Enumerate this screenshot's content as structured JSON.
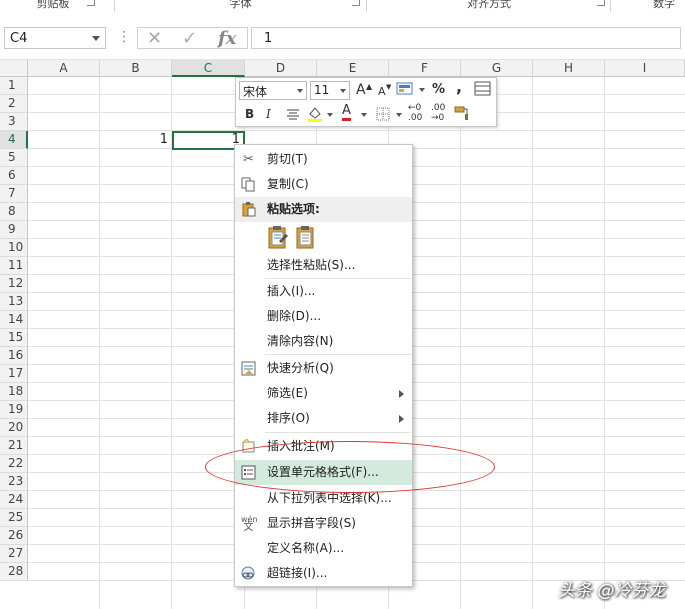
{
  "ribbon": {
    "groups": [
      "剪贴板",
      "字体",
      "对齐方式",
      "数字"
    ]
  },
  "formula_bar": {
    "name_box": "C4",
    "cancel_icon": "✕",
    "enter_icon": "✓",
    "fx_label": "fx",
    "value": "1"
  },
  "columns": [
    "A",
    "B",
    "C",
    "D",
    "E",
    "F",
    "G",
    "H",
    "I"
  ],
  "rows": [
    "1",
    "2",
    "3",
    "4",
    "5",
    "6",
    "7",
    "8",
    "9",
    "10",
    "11",
    "12",
    "13",
    "14",
    "15",
    "16",
    "17",
    "18",
    "19",
    "20",
    "21",
    "22",
    "23",
    "24",
    "25",
    "26",
    "27",
    "28"
  ],
  "cells": {
    "B4": "1",
    "C4": "1"
  },
  "mini_toolbar": {
    "font_name": "宋体",
    "font_size": "11",
    "grow_font": "A",
    "shrink_font": "A",
    "percent": "%",
    "comma": ",",
    "bold": "B",
    "italic": "I",
    "font_color_letter": "A",
    "dec_increase": ".00",
    "dec_decrease": ".00"
  },
  "context_menu": {
    "items": [
      {
        "label": "剪切(T)",
        "icon": "scissors-icon"
      },
      {
        "label": "复制(C)",
        "icon": "copy-icon"
      },
      {
        "label": "粘贴选项:",
        "icon": "paste-icon"
      },
      {
        "label": "选择性粘贴(S)...",
        "icon": ""
      },
      {
        "label": "插入(I)...",
        "icon": ""
      },
      {
        "label": "删除(D)...",
        "icon": ""
      },
      {
        "label": "清除内容(N)",
        "icon": ""
      },
      {
        "label": "快速分析(Q)",
        "icon": "quick-analysis-icon"
      },
      {
        "label": "筛选(E)",
        "icon": ""
      },
      {
        "label": "排序(O)",
        "icon": ""
      },
      {
        "label": "插入批注(M)",
        "icon": "comment-icon"
      },
      {
        "label": "设置单元格格式(F)...",
        "icon": "format-cells-icon"
      },
      {
        "label": "从下拉列表中选择(K)...",
        "icon": ""
      },
      {
        "label": "显示拼音字段(S)",
        "icon": "phonetic-icon"
      },
      {
        "label": "定义名称(A)...",
        "icon": ""
      },
      {
        "label": "超链接(I)...",
        "icon": "hyperlink-icon"
      }
    ],
    "phonetic_glyph": "wén",
    "phonetic_char": "文"
  },
  "watermark": "头条 @冷芬龙",
  "colors": {
    "accent": "#217346",
    "highlight": "#d3eadd",
    "annotation": "#e03a3a"
  }
}
